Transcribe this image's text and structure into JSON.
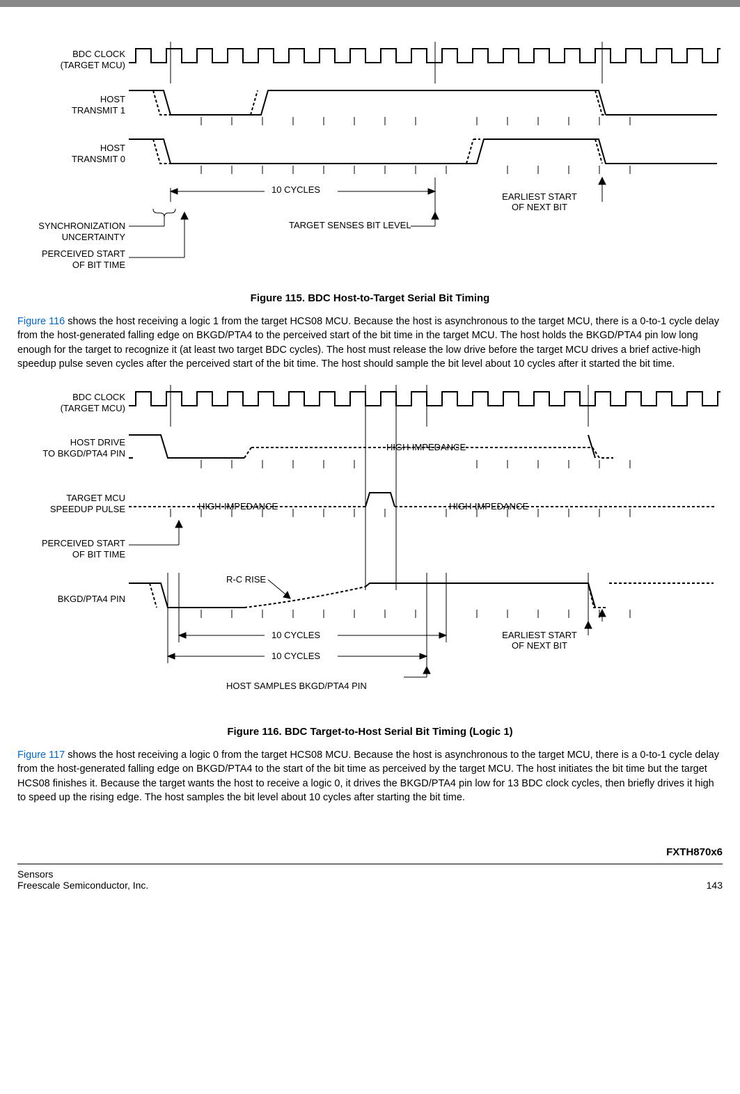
{
  "fig115": {
    "labels": {
      "bdc_clock_l1": "BDC CLOCK",
      "bdc_clock_l2": "(TARGET MCU)",
      "host_tx1_l1": "HOST",
      "host_tx1_l2": "TRANSMIT 1",
      "host_tx0_l1": "HOST",
      "host_tx0_l2": "TRANSMIT 0",
      "sync_unc_l1": "SYNCHRONIZATION",
      "sync_unc_l2": "UNCERTAINTY",
      "perceived_l1": "PERCEIVED START",
      "perceived_l2": "OF BIT TIME",
      "ten_cycles": "10 CYCLES",
      "target_senses": "TARGET SENSES BIT LEVEL",
      "earliest_l1": "EARLIEST START",
      "earliest_l2": "OF NEXT BIT"
    },
    "caption": "Figure 115. BDC Host-to-Target Serial Bit Timing"
  },
  "para1": {
    "ref": "Figure 116",
    "text": " shows the host receiving a logic 1 from the target HCS08 MCU. Because the host is asynchronous to the target MCU, there is a 0-to-1 cycle delay from the host-generated falling edge on BKGD/PTA4 to the perceived start of the bit time in the target MCU. The host holds the BKGD/PTA4 pin low long enough for the target to recognize it (at least two target BDC cycles). The host must release the low drive before the target MCU drives a brief active-high speedup pulse seven cycles after the perceived start of the bit time. The host should sample the bit level about 10 cycles after it started the bit time."
  },
  "fig116": {
    "labels": {
      "bdc_clock_l1": "BDC CLOCK",
      "bdc_clock_l2": "(TARGET MCU)",
      "host_drive_l1": "HOST DRIVE",
      "host_drive_l2": "TO BKGD/PTA4 PIN",
      "target_mcu_l1": "TARGET MCU",
      "target_mcu_l2": "SPEEDUP PULSE",
      "perceived_l1": "PERCEIVED START",
      "perceived_l2": "OF BIT TIME",
      "bkgd_pin": "BKGD/PTA4 PIN",
      "hi_z": "HIGH-IMPEDANCE",
      "rc_rise": "R-C RISE",
      "ten_cycles": "10 CYCLES",
      "host_samples": "HOST SAMPLES BKGD/PTA4 PIN",
      "earliest_l1": "EARLIEST START",
      "earliest_l2": "OF NEXT BIT"
    },
    "caption": "Figure 116. BDC Target-to-Host Serial Bit Timing (Logic 1)"
  },
  "para2": {
    "ref": "Figure 117",
    "text": " shows the host receiving a logic 0 from the target HCS08 MCU. Because the host is asynchronous to the target MCU, there is a 0-to-1 cycle delay from the host-generated falling edge on BKGD/PTA4 to the start of the bit time as perceived by the target MCU. The host initiates the bit time but the target HCS08 finishes it. Because the target wants the host to receive a logic 0, it drives the BKGD/PTA4 pin low for 13 BDC clock cycles, then briefly drives it high to speed up the rising edge. The host samples the bit level about 10 cycles after starting the bit time."
  },
  "footer": {
    "product": "FXTH870x6",
    "left1": "Sensors",
    "left2": "Freescale Semiconductor, Inc.",
    "page": "143"
  },
  "chart_data": [
    {
      "type": "timing_diagram",
      "title": "BDC Host-to-Target Serial Bit Timing",
      "signals": [
        {
          "name": "BDC CLOCK (TARGET MCU)",
          "waveform": "clock",
          "period_cycles": 1,
          "total_cycles": 17
        },
        {
          "name": "HOST TRANSMIT 1",
          "waveform": "bit",
          "events": [
            {
              "t": 0,
              "v": "hi"
            },
            {
              "t": 1,
              "v": "fall"
            },
            {
              "t": 4,
              "v": "rise"
            },
            {
              "t": 16,
              "v": "fall_next"
            }
          ]
        },
        {
          "name": "HOST TRANSMIT 0",
          "waveform": "bit",
          "events": [
            {
              "t": 0,
              "v": "hi"
            },
            {
              "t": 1,
              "v": "fall"
            },
            {
              "t": 11,
              "v": "rise"
            },
            {
              "t": 16,
              "v": "fall_next"
            }
          ]
        }
      ],
      "annotations": [
        {
          "text": "10 CYCLES",
          "from_cycle": 1,
          "to_cycle": 11
        },
        {
          "text": "TARGET SENSES BIT LEVEL",
          "at_cycle": 11
        },
        {
          "text": "EARLIEST START OF NEXT BIT",
          "at_cycle": 16
        },
        {
          "text": "SYNCHRONIZATION UNCERTAINTY",
          "span_cycles": [
            0.7,
            1.3
          ]
        },
        {
          "text": "PERCEIVED START OF BIT TIME",
          "at_cycle": 1.3
        }
      ]
    },
    {
      "type": "timing_diagram",
      "title": "BDC Target-to-Host Serial Bit Timing (Logic 1)",
      "signals": [
        {
          "name": "BDC CLOCK (TARGET MCU)",
          "waveform": "clock",
          "period_cycles": 1,
          "total_cycles": 17
        },
        {
          "name": "HOST DRIVE TO BKGD/PTA4 PIN",
          "waveform": "drive",
          "events": [
            {
              "t": 0,
              "v": "hi"
            },
            {
              "t": 1,
              "v": "fall"
            },
            {
              "t": 3.5,
              "v": "release_hiZ"
            },
            {
              "t": 16,
              "v": "fall_next"
            }
          ],
          "hi_z_regions": [
            [
              3.5,
              16
            ]
          ]
        },
        {
          "name": "TARGET MCU SPEEDUP PULSE",
          "waveform": "pulse",
          "hi_z_regions": [
            [
              0,
              8
            ],
            [
              9,
              17
            ]
          ],
          "pulse": [
            8,
            9
          ]
        },
        {
          "name": "BKGD/PTA4 PIN",
          "waveform": "composite",
          "events": [
            {
              "t": 0,
              "v": "hi"
            },
            {
              "t": 1,
              "v": "fall"
            },
            {
              "t": 3.5,
              "v": "rc_rise_start"
            },
            {
              "t": 8,
              "v": "hi"
            },
            {
              "t": 16,
              "v": "fall_next"
            }
          ]
        }
      ],
      "annotations": [
        {
          "text": "HIGH-IMPEDANCE",
          "signal": "HOST DRIVE",
          "span_cycles": [
            3.5,
            16
          ]
        },
        {
          "text": "HIGH-IMPEDANCE",
          "signal": "SPEEDUP PULSE",
          "span_cycles": [
            0,
            8
          ]
        },
        {
          "text": "HIGH-IMPEDANCE",
          "signal": "SPEEDUP PULSE",
          "span_cycles": [
            9,
            17
          ]
        },
        {
          "text": "R-C RISE",
          "signal": "BKGD/PTA4 PIN",
          "at_cycle": 5
        },
        {
          "text": "10 CYCLES",
          "from_cycle": 1.3,
          "to_cycle": 11.3
        },
        {
          "text": "10 CYCLES",
          "from_cycle": 1,
          "to_cycle": 11
        },
        {
          "text": "HOST SAMPLES BKGD/PTA4 PIN",
          "at_cycle": 11
        },
        {
          "text": "EARLIEST START OF NEXT BIT",
          "at_cycle": 16
        },
        {
          "text": "PERCEIVED START OF BIT TIME",
          "at_cycle": 1.3
        }
      ]
    }
  ]
}
